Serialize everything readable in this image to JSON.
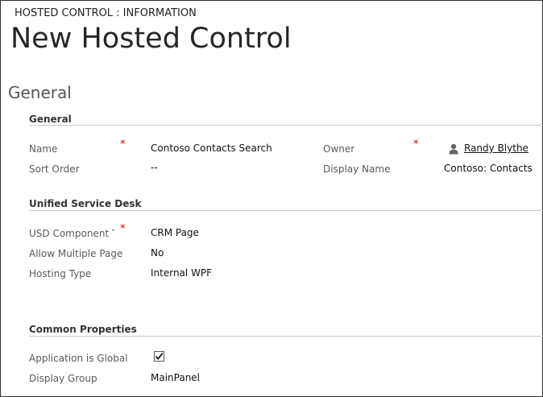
{
  "header": {
    "breadcrumb": "HOSTED CONTROL : INFORMATION",
    "title": "New Hosted Control"
  },
  "tab": {
    "title": "General"
  },
  "sections": {
    "general": {
      "title": "General",
      "name_label": "Name",
      "name_value": "Contoso Contacts Search",
      "sort_order_label": "Sort Order",
      "sort_order_value": "--",
      "owner_label": "Owner",
      "owner_value": "Randy Blythe",
      "display_name_label": "Display Name",
      "display_name_value": "Contoso: Contacts"
    },
    "usd": {
      "title": "Unified Service Desk",
      "component_type_label": "USD Component Type",
      "component_type_value": "CRM Page",
      "allow_multiple_label": "Allow Multiple Pages",
      "allow_multiple_value": "No",
      "hosting_type_label": "Hosting Type",
      "hosting_type_value": "Internal WPF"
    },
    "common": {
      "title": "Common Properties",
      "app_global_label": "Application is Global",
      "app_global_checked": true,
      "display_group_label": "Display Group",
      "display_group_value": "MainPanel"
    }
  },
  "required_marker": "*",
  "icons": {
    "owner": "person-icon",
    "checkbox": "checkmark-icon"
  },
  "colors": {
    "required": "#d80000",
    "divider": "#c8c8c8"
  }
}
